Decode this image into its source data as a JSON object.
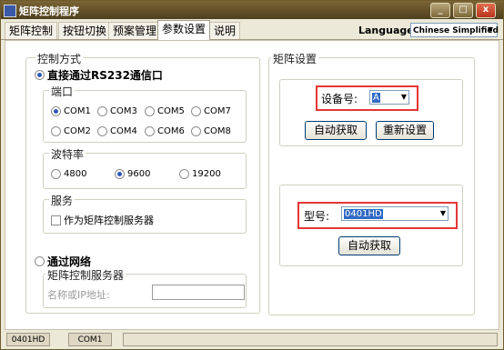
{
  "window": {
    "title": "矩阵控制程序"
  },
  "tabs": [
    "矩阵控制",
    "按钮切换",
    "预案管理",
    "参数设置",
    "说明"
  ],
  "active_tab": "参数设置",
  "language": {
    "label": "Language:",
    "value": "Chinese Simplified"
  },
  "control_mode": {
    "title": "控制方式",
    "rs232": {
      "label": "直接通过RS232通信口",
      "port": {
        "title": "端口",
        "options": [
          "COM1",
          "COM3",
          "COM5",
          "COM7",
          "COM2",
          "COM4",
          "COM6",
          "COM8"
        ],
        "selected": "COM1"
      },
      "baud": {
        "title": "波特率",
        "options": [
          "4800",
          "9600",
          "19200"
        ],
        "selected": "9600"
      },
      "service": {
        "title": "服务",
        "checkbox_label": "作为矩阵控制服务器"
      }
    },
    "network": {
      "label": "通过网络",
      "server_title": "矩阵控制服务器",
      "name_label": "名称或IP地址:",
      "name_value": ""
    }
  },
  "matrix_settings": {
    "title": "矩阵设置",
    "device_label": "设备号:",
    "device_value": "A",
    "auto_get_label": "自动获取",
    "reset_label": "重新设置",
    "model_label": "型号:",
    "model_value": "0401HD",
    "model_auto_get_label": "自动获取"
  },
  "status": {
    "model": "0401HD",
    "port": "COM1"
  }
}
